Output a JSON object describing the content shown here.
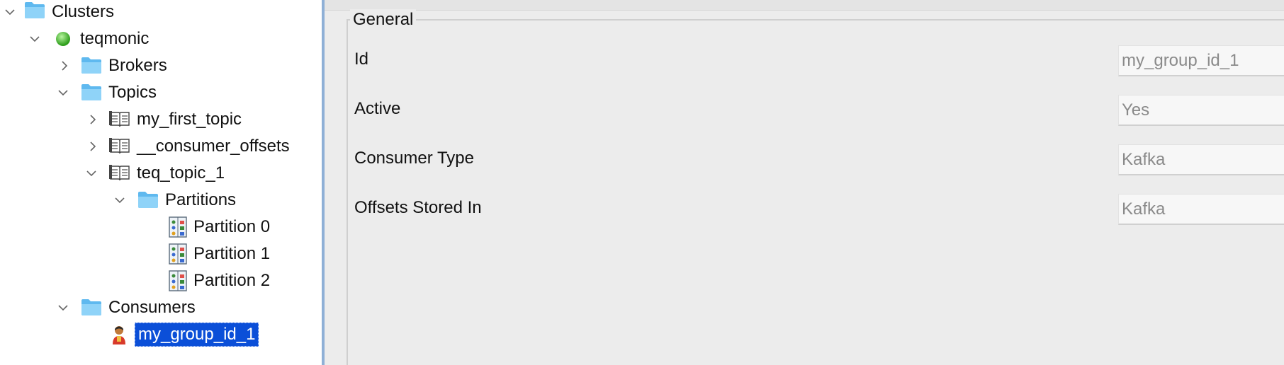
{
  "tree": {
    "clusters": {
      "label": "Clusters",
      "icon": "folder-icon",
      "expanded": true
    },
    "cluster": {
      "label": "teqmonic",
      "icon": "status-green-dot-icon",
      "status_color": "#3fbf2a",
      "expanded": true
    },
    "brokers": {
      "label": "Brokers",
      "icon": "folder-icon",
      "expanded": false
    },
    "topics": {
      "label": "Topics",
      "icon": "folder-icon",
      "expanded": true
    },
    "topic_items": [
      {
        "label": "my_first_topic",
        "icon": "topic-book-icon",
        "expanded": false
      },
      {
        "label": "__consumer_offsets",
        "icon": "topic-book-icon",
        "expanded": false
      },
      {
        "label": "teq_topic_1",
        "icon": "topic-book-icon",
        "expanded": true
      }
    ],
    "partitions": {
      "label": "Partitions",
      "icon": "folder-icon",
      "expanded": true
    },
    "partition_items": [
      {
        "label": "Partition 0",
        "icon": "partition-icon"
      },
      {
        "label": "Partition 1",
        "icon": "partition-icon"
      },
      {
        "label": "Partition 2",
        "icon": "partition-icon"
      }
    ],
    "consumers": {
      "label": "Consumers",
      "icon": "folder-icon",
      "expanded": true
    },
    "consumer_items": [
      {
        "label": "my_group_id_1",
        "icon": "consumer-person-icon",
        "selected": true
      }
    ]
  },
  "detail": {
    "group_title": "General",
    "fields": [
      {
        "label": "Id",
        "value": "my_group_id_1"
      },
      {
        "label": "Active",
        "value": "Yes"
      },
      {
        "label": "Consumer Type",
        "value": "Kafka"
      },
      {
        "label": "Offsets Stored In",
        "value": "Kafka"
      }
    ]
  },
  "colors": {
    "folder": "#6cc3f3",
    "selection": "#0b4fd8",
    "status_ok": "#3fbf2a",
    "splitter": "#8fb0d6"
  }
}
